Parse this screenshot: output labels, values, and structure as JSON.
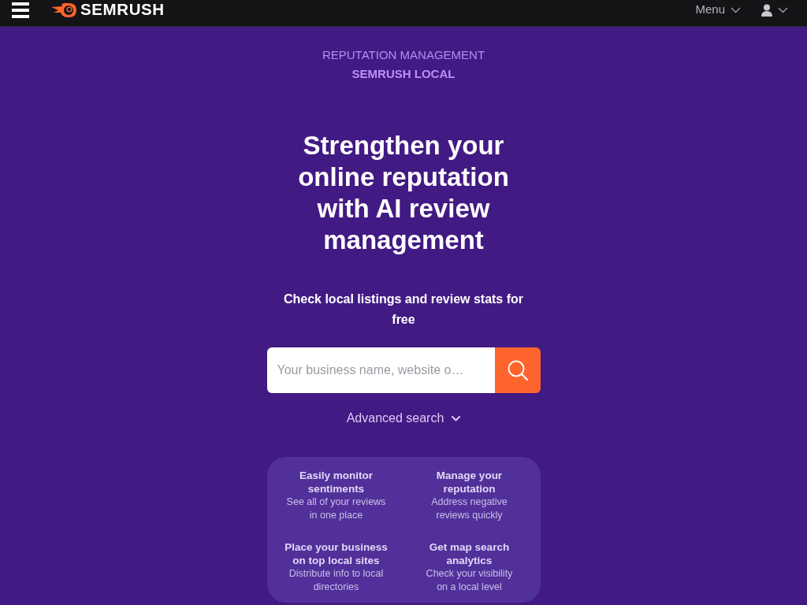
{
  "navbar": {
    "brand": "SEMRUSH",
    "menu_label": "Menu"
  },
  "hero": {
    "eyebrow": "REPUTATION MANAGEMENT",
    "product": "SEMRUSH LOCAL",
    "title": "Strengthen your online reputation with AI review management",
    "subtitle": "Check local listings and review stats for free"
  },
  "search": {
    "placeholder": "Your business name, website o…",
    "advanced_label": "Advanced search"
  },
  "features": [
    {
      "title": "Easily monitor sentiments",
      "description": "See all of your reviews in one place"
    },
    {
      "title": "Manage your reputation",
      "description": "Address negative reviews quickly"
    },
    {
      "title": "Place your business on top local sites",
      "description": "Distribute info to local directories"
    },
    {
      "title": "Get map search analytics",
      "description": "Check your visibility on a local level"
    }
  ]
}
